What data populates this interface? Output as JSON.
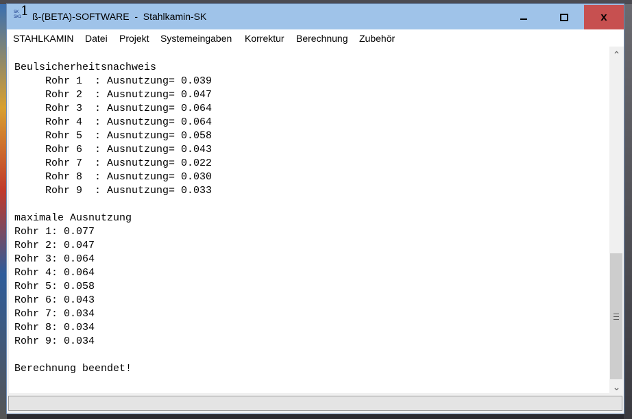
{
  "window": {
    "title": "ß-(BETA)-SOFTWARE  -  Stahlkamin-SK",
    "icon_text": [
      "SK",
      "SW1"
    ],
    "icon_big": "1"
  },
  "caption_buttons": {
    "minimize": "minimize-icon",
    "maximize": "maximize-icon",
    "close": "close-icon",
    "close_glyph": "x"
  },
  "menu": [
    {
      "label": "STAHLKAMIN"
    },
    {
      "label": "Datei"
    },
    {
      "label": "Projekt"
    },
    {
      "label": "Systemeingaben"
    },
    {
      "label": "Korrektur"
    },
    {
      "label": "Berechnung"
    },
    {
      "label": "Zubehör"
    }
  ],
  "scrollbar": {
    "up_glyph": "⌃",
    "down_glyph": "⌄"
  },
  "output_lines": [
    "Beulsicherheitsnachweis",
    "     Rohr 1  : Ausnutzung= 0.039",
    "     Rohr 2  : Ausnutzung= 0.047",
    "     Rohr 3  : Ausnutzung= 0.064",
    "     Rohr 4  : Ausnutzung= 0.064",
    "     Rohr 5  : Ausnutzung= 0.058",
    "     Rohr 6  : Ausnutzung= 0.043",
    "     Rohr 7  : Ausnutzung= 0.022",
    "     Rohr 8  : Ausnutzung= 0.030",
    "     Rohr 9  : Ausnutzung= 0.033",
    "",
    "maximale Ausnutzung",
    "Rohr 1: 0.077",
    "Rohr 2: 0.047",
    "Rohr 3: 0.064",
    "Rohr 4: 0.064",
    "Rohr 5: 0.058",
    "Rohr 6: 0.043",
    "Rohr 7: 0.034",
    "Rohr 8: 0.034",
    "Rohr 9: 0.034",
    "",
    "Berechnung beendet!"
  ],
  "colors": {
    "titlebar": "#9fc3e9",
    "close_button": "#c75050"
  }
}
